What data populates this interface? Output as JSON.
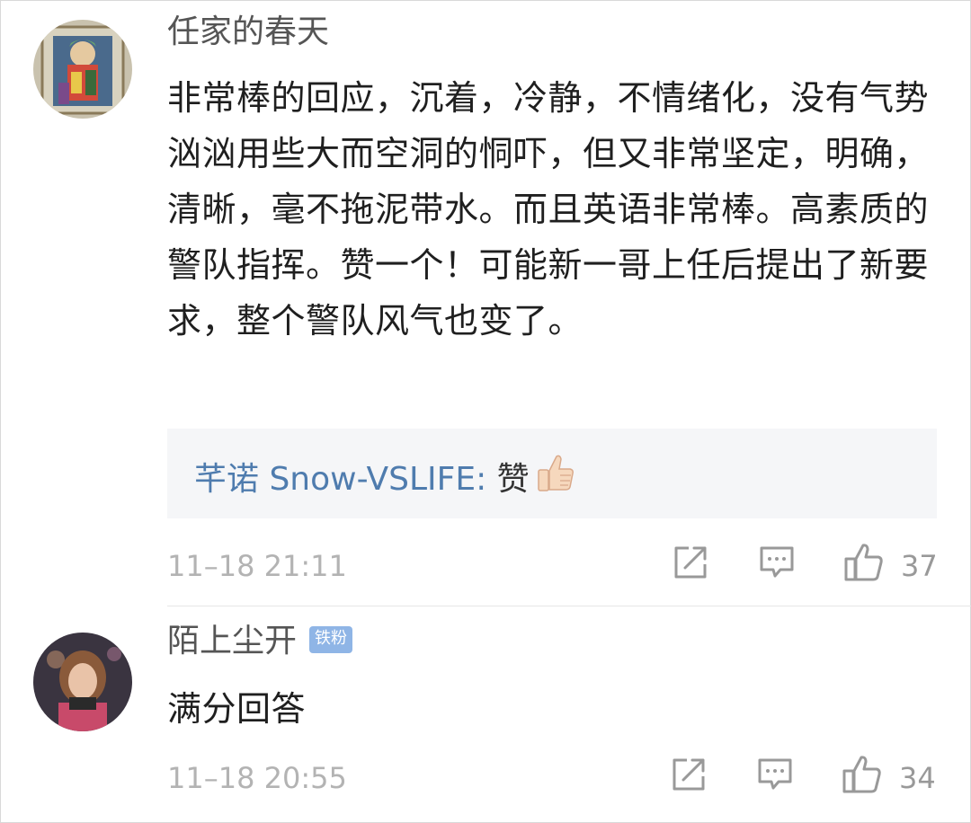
{
  "comments": [
    {
      "username": "任家的春天",
      "badge": "",
      "text": "非常棒的回应，沉着，冷静，不情绪化，没有气势汹汹用些大而空洞的恫吓，但又非常坚定，明确，清晰，毫不拖泥带水。而且英语非常棒。高素质的警队指挥。赞一个！可能新一哥上任后提出了新要求，整个警队风气也变了。",
      "reply": {
        "author": "芊诺 Snow-VSLIFE:",
        "content": " 赞",
        "emoji": "thumbs-up-emoji"
      },
      "timestamp": "11–18 21:11",
      "likes": "37",
      "icons": [
        "share-icon",
        "comment-icon",
        "like-icon"
      ]
    },
    {
      "username": "陌上尘开",
      "badge": "铁粉",
      "text": "满分回答",
      "timestamp": "11–18 20:55",
      "likes": "34",
      "icons": [
        "share-icon",
        "comment-icon",
        "like-icon"
      ]
    }
  ],
  "colors": {
    "username": "#555555",
    "reply_author": "#4f7cae",
    "badge": "#8fb5e6",
    "meta": "#b3b3b3",
    "reply_bg": "#f5f6f8"
  }
}
